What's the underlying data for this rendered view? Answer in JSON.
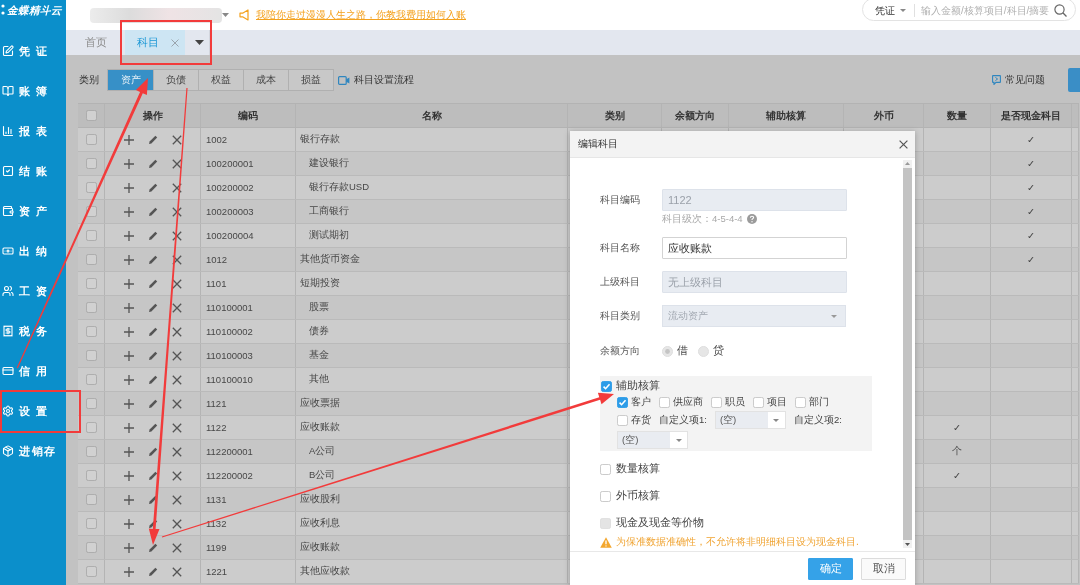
{
  "sidebar": {
    "logo": "金蝶精斗云",
    "items": [
      "凭证",
      "账簿",
      "报表",
      "结账",
      "资产",
      "出纳",
      "工资",
      "税务",
      "信用",
      "设置",
      "进销存"
    ]
  },
  "top_bar": {
    "announcement": "我陪你走过漫漫人生之路，你教我费用如何入账",
    "search": {
      "scope": "凭证",
      "placeholder": "输入金额/核算项目/科目/摘要"
    }
  },
  "tabs": [
    {
      "label": "首页",
      "selected": false,
      "closable": false
    },
    {
      "label": "科目",
      "selected": true,
      "closable": true
    }
  ],
  "category_filter": {
    "label": "类别",
    "options": [
      {
        "label": "资产",
        "selected": true
      },
      {
        "label": "负债",
        "selected": false
      },
      {
        "label": "权益",
        "selected": false
      },
      {
        "label": "成本",
        "selected": false
      },
      {
        "label": "损益",
        "selected": false
      }
    ],
    "guide_link": "科目设置流程"
  },
  "faq_link": "常见问题",
  "table": {
    "header_checked": false,
    "columns": [
      "操作",
      "编码",
      "名称",
      "类别",
      "余额方向",
      "辅助核算",
      "外币",
      "数量",
      "是否现金科目"
    ],
    "rows": [
      {
        "code": "1002",
        "name": "银行存款",
        "checked": false,
        "cash": "✓",
        "children": [
          {
            "code": "100200001",
            "name": "建设银行",
            "checked": false,
            "cash": "✓"
          },
          {
            "code": "100200002",
            "name": "银行存款USD",
            "checked": false,
            "cash": "✓"
          },
          {
            "code": "100200003",
            "name": "工商银行",
            "checked": false,
            "cash": "✓"
          },
          {
            "code": "100200004",
            "name": "测试期初",
            "checked": false,
            "cash": "✓"
          }
        ]
      },
      {
        "code": "1012",
        "name": "其他货币资金",
        "checked": false,
        "cash": "✓"
      },
      {
        "code": "1101",
        "name": "短期投资",
        "checked": false,
        "children": [
          {
            "code": "110100001",
            "name": "股票",
            "checked": false
          },
          {
            "code": "110100002",
            "name": "债券",
            "checked": false
          },
          {
            "code": "110100003",
            "name": "基金",
            "checked": false
          },
          {
            "code": "110100010",
            "name": "其他",
            "checked": false
          }
        ]
      },
      {
        "code": "1121",
        "name": "应收票据",
        "checked": false
      },
      {
        "code": "1122",
        "name": "应收账款",
        "checked": false,
        "quantity": "✓",
        "children": [
          {
            "code": "112200001",
            "name": "A公司",
            "checked": false,
            "quantity": "个"
          },
          {
            "code": "112200002",
            "name": "B公司",
            "checked": false,
            "quantity": "✓"
          }
        ]
      },
      {
        "code": "1131",
        "name": "应收股利",
        "checked": false
      },
      {
        "code": "1132",
        "name": "应收利息",
        "checked": false
      },
      {
        "code": "1199",
        "name": "应收账款",
        "checked": false
      },
      {
        "code": "1221",
        "name": "其他应收款",
        "checked": false
      }
    ]
  },
  "dialog": {
    "title": "编辑科目",
    "fields": [
      {
        "kind": "input",
        "label": "科目编码",
        "value": "1122",
        "disabled": true,
        "hint": "科目级次：4-5-4-4"
      },
      {
        "kind": "input",
        "label": "科目名称",
        "value": "应收账款",
        "disabled": false
      },
      {
        "kind": "input",
        "label": "上级科目",
        "value": "无上级科目",
        "disabled": true
      },
      {
        "kind": "select",
        "label": "科目类别",
        "value": "流动资产",
        "disabled": true
      },
      {
        "kind": "radio",
        "label": "余额方向",
        "disabled": true,
        "options": [
          {
            "label": "借",
            "selected": true
          },
          {
            "label": "贷",
            "selected": false
          }
        ]
      }
    ],
    "auxiliary": {
      "label": "辅助核算",
      "checked": true,
      "options": [
        {
          "label": "客户",
          "checked": true
        },
        {
          "label": "供应商",
          "checked": false
        },
        {
          "label": "职员",
          "checked": false
        },
        {
          "label": "项目",
          "checked": false
        },
        {
          "label": "部门",
          "checked": false
        },
        {
          "label": "存货",
          "checked": false
        }
      ],
      "custom": [
        {
          "label": "自定义项1:",
          "value": "(空)"
        },
        {
          "label": "自定义项2:",
          "value": "(空)"
        }
      ]
    },
    "options": [
      {
        "label": "数量核算",
        "checked": false,
        "disabled": false
      },
      {
        "label": "外币核算",
        "checked": false,
        "disabled": false
      },
      {
        "label": "现金及现金等价物",
        "checked": false,
        "disabled": true
      }
    ],
    "warning": "为保准数据准确性，不允许将非明细科目设为现金科目.",
    "buttons": [
      {
        "label": "确定",
        "kind": "primary"
      },
      {
        "label": "取消",
        "kind": "secondary"
      }
    ]
  }
}
